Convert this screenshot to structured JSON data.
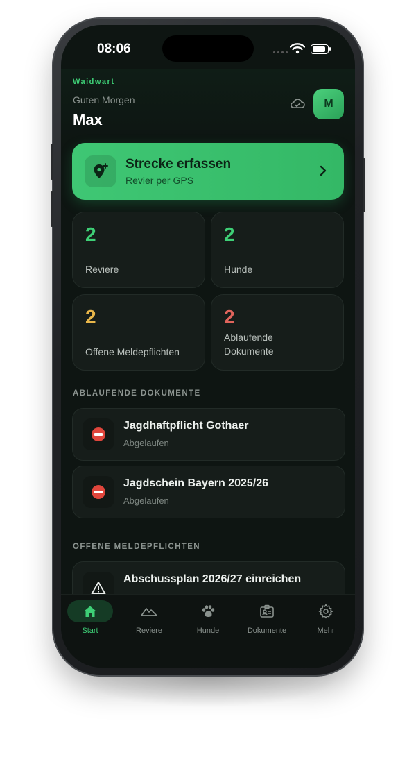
{
  "status": {
    "time": "08:06"
  },
  "header": {
    "brand": "Waidwart",
    "greeting": "Guten Morgen",
    "name": "Max",
    "avatar_initial": "M"
  },
  "cta": {
    "title": "Strecke erfassen",
    "subtitle": "Revier per GPS"
  },
  "stats": [
    {
      "value": "2",
      "label": "Reviere",
      "color": "#3ecf76"
    },
    {
      "value": "2",
      "label": "Hunde",
      "color": "#3ecf76"
    },
    {
      "value": "2",
      "label": "Offene Meldepflichten",
      "color": "#e8b64a"
    },
    {
      "value": "2",
      "label_line1": "Ablaufende",
      "label_line2": "Dokumente",
      "color": "#e0645c"
    }
  ],
  "sections": {
    "expiring_title": "ABLAUFENDE DOKUMENTE",
    "open_title": "OFFENE MELDEPFLICHTEN"
  },
  "expiring_docs": [
    {
      "title": "Jagdhaftpflicht Gothaer",
      "status": "Abgelaufen",
      "icon": "no-entry-icon"
    },
    {
      "title": "Jagdschein Bayern 2025/26",
      "status": "Abgelaufen",
      "icon": "no-entry-icon"
    }
  ],
  "open_duties": [
    {
      "title": "Abschussplan 2026/27 einreichen",
      "icon": "warning-icon"
    }
  ],
  "tabs": [
    {
      "label": "Start",
      "icon": "home-icon",
      "active": true
    },
    {
      "label": "Reviere",
      "icon": "mountain-icon"
    },
    {
      "label": "Hunde",
      "icon": "paw-icon"
    },
    {
      "label": "Dokumente",
      "icon": "id-card-icon"
    },
    {
      "label": "Mehr",
      "icon": "gear-icon"
    }
  ],
  "colors": {
    "accent": "#3ecf76",
    "background": "#0e1512",
    "card": "#161d1a"
  }
}
